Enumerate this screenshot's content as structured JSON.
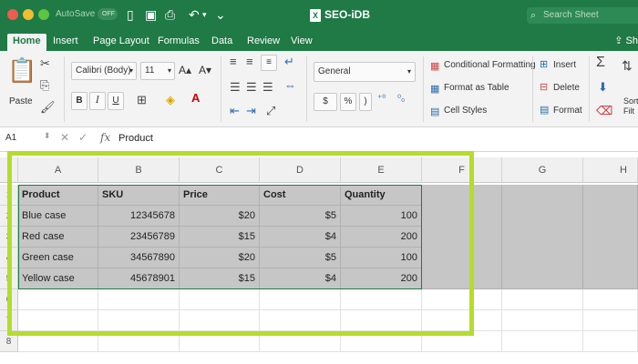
{
  "window": {
    "autosave_label": "AutoSave",
    "autosave_state": "OFF",
    "doc_title": "SEO-iDB",
    "search_placeholder": "Search Sheet"
  },
  "tabs": [
    {
      "label": "Home",
      "active": true
    },
    {
      "label": "Insert"
    },
    {
      "label": "Page Layout"
    },
    {
      "label": "Formulas"
    },
    {
      "label": "Data"
    },
    {
      "label": "Review"
    },
    {
      "label": "View"
    }
  ],
  "share_label": "Sh",
  "ribbon": {
    "paste_label": "Paste",
    "font_name": "Calibri (Body)",
    "font_size": "11",
    "bold": "B",
    "italic": "I",
    "underline": "U",
    "number_format": "General",
    "currency": "$",
    "percent": "%",
    "comma": ")",
    "conditional_formatting": "Conditional Formatting",
    "format_as_table": "Format as Table",
    "cell_styles": "Cell Styles",
    "insert": "Insert",
    "delete": "Delete",
    "format": "Format",
    "sort_filter": "Sort\nFilt"
  },
  "formula_bar": {
    "name_box": "A1",
    "fx": "fx",
    "value": "Product"
  },
  "columns": [
    "A",
    "B",
    "C",
    "D",
    "E",
    "F",
    "G",
    "H"
  ],
  "rows": [
    "1",
    "2",
    "3",
    "4",
    "5",
    "6",
    "7",
    "8"
  ],
  "table": {
    "headers": [
      "Product",
      "SKU",
      "Price",
      "Cost",
      "Quantity"
    ],
    "data": [
      [
        "Blue case",
        "12345678",
        "$20",
        "$5",
        "100"
      ],
      [
        "Red case",
        "23456789",
        "$15",
        "$4",
        "200"
      ],
      [
        "Green case",
        "34567890",
        "$20",
        "$5",
        "100"
      ],
      [
        "Yellow case",
        "45678901",
        "$15",
        "$4",
        "200"
      ]
    ]
  },
  "colors": {
    "excel_green": "#1f7a45",
    "selection_gray": "#c6c6c6",
    "highlight_lime": "#b6dc2a"
  }
}
